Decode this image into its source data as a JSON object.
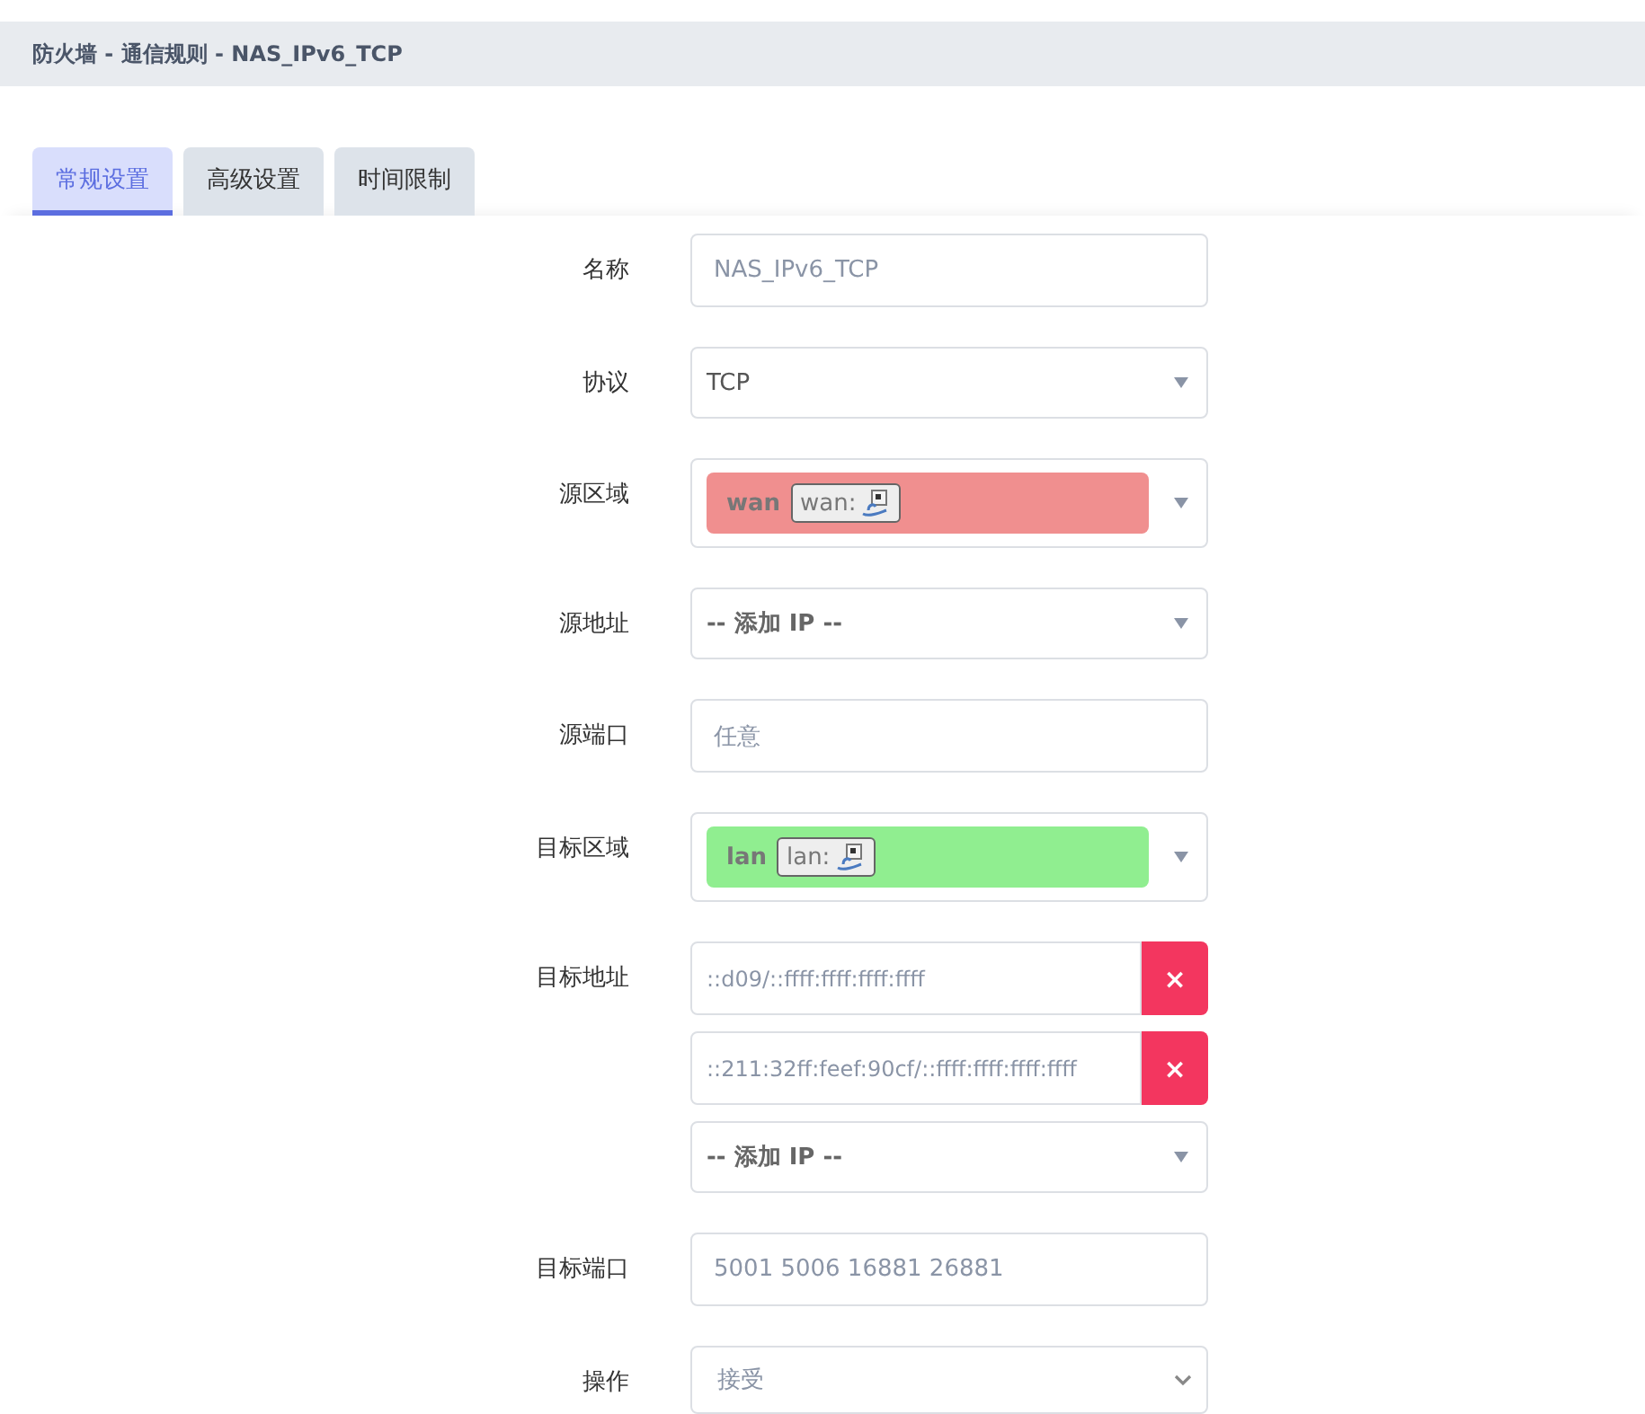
{
  "title": "防火墙 - 通信规则 - NAS_IPv6_TCP",
  "tabs": [
    {
      "label": "常规设置",
      "selected": true
    },
    {
      "label": "高级设置",
      "selected": false
    },
    {
      "label": "时间限制",
      "selected": false
    }
  ],
  "fields": [
    {
      "label": "名称",
      "kind": "text",
      "value": "NAS_IPv6_TCP"
    },
    {
      "label": "协议",
      "kind": "select",
      "value": "TCP",
      "bold": false
    },
    {
      "label": "源区域",
      "kind": "zone",
      "zone": "wan",
      "badge": "wan:",
      "color": "#f08f8f"
    },
    {
      "label": "源地址",
      "kind": "select",
      "value": "-- 添加 IP --",
      "bold": true
    },
    {
      "label": "源端口",
      "kind": "text",
      "value": "任意"
    },
    {
      "label": "目标区域",
      "kind": "zone",
      "zone": "lan",
      "badge": "lan:",
      "color": "#90ee90"
    },
    {
      "label": "目标地址",
      "kind": "list",
      "items": [
        "::d09/::ffff:ffff:ffff:ffff",
        "::211:32ff:feef:90cf/::ffff:ffff:ffff:ffff"
      ],
      "remove": "×",
      "add": "-- 添加 IP --"
    },
    {
      "label": "目标端口",
      "kind": "text",
      "value": "5001 5006 16881 26881"
    },
    {
      "label": "操作",
      "kind": "native",
      "value": "接受"
    }
  ]
}
